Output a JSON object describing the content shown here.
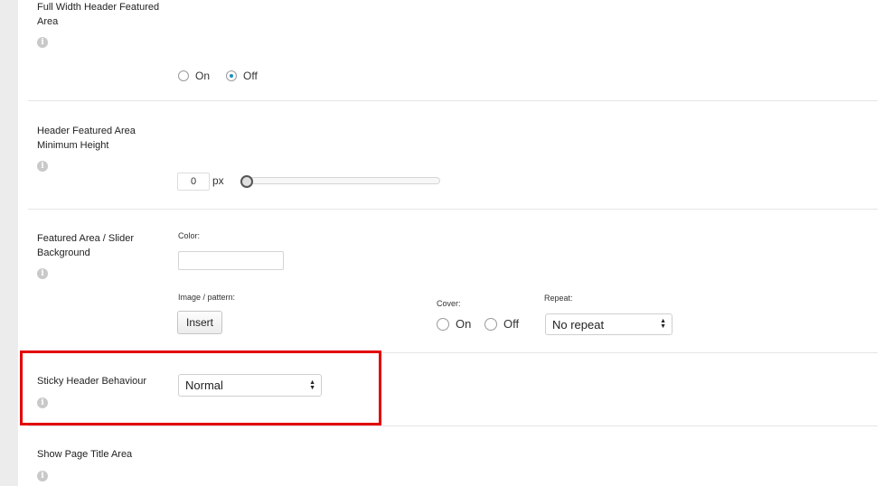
{
  "settings": {
    "full_width": {
      "label": "Full Width Header Featured Area",
      "options": [
        "On",
        "Off"
      ],
      "selected": "Off"
    },
    "min_height": {
      "label": "Header Featured Area Minimum Height",
      "value": "0",
      "unit": "px",
      "slider_level": 0
    },
    "background": {
      "label": "Featured Area / Slider Background",
      "color_label": "Color:",
      "color_value": "",
      "image_label": "Image / pattern:",
      "insert_label": "Insert",
      "cover_label": "Cover:",
      "cover_options": [
        "On",
        "Off"
      ],
      "repeat_label": "Repeat:",
      "repeat_value": "No repeat"
    },
    "sticky": {
      "label": "Sticky Header Behaviour",
      "value": "Normal"
    },
    "page_title": {
      "label": "Show Page Title Area"
    }
  },
  "icons": {
    "info_glyph": "i"
  },
  "colors": {
    "highlight": "#e30000",
    "radio_accent": "#1e8cbe"
  }
}
